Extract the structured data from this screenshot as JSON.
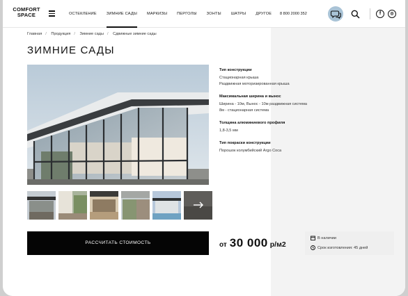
{
  "header": {
    "logo_line1": "COMFORT",
    "logo_line2": "SPACE",
    "nav": [
      "ОСТЕКЛЕНИЕ",
      "ЗИМНИЕ САДЫ",
      "МАРКИЗЫ",
      "ПЕРГОЛЫ",
      "ЗОНТЫ",
      "ШАТРЫ",
      "ДРУГОЕ"
    ],
    "active_nav": "ЗИМНИЕ САДЫ",
    "phone": "8 800 2000 352",
    "social": [
      "f",
      "◎"
    ]
  },
  "breadcrumb": [
    "Главная",
    "Продукция",
    "Зимние сады",
    "Сдвижные зимние сады"
  ],
  "page_title": "ЗИМНИЕ САДЫ",
  "specs": [
    {
      "heading": "Тип конструкции",
      "lines": [
        "Стационарная крыша",
        "Раздвижная моторизированная крыша"
      ]
    },
    {
      "heading": "Максимальная ширина и вынос",
      "lines": [
        "Ширина - 10м, Вынос - 10м раздвижная система",
        "8м - стационарная система"
      ]
    },
    {
      "heading": "Толщина алюминиевого профиля",
      "lines": [
        "1,8-3,5 мм"
      ]
    },
    {
      "heading": "Тип покраски конструкции",
      "lines": [
        "Порошок колумбийский Argo Coca"
      ]
    }
  ],
  "cta_button": "РАССЧИТАТЬ СТОИМОСТЬ",
  "price": {
    "prefix": "от",
    "value": "30 000",
    "unit": "р/м2"
  },
  "availability": {
    "status": "В наличии",
    "lead_time": "Срок изготовления: 45 дней"
  },
  "icons": {
    "menu": "hamburger-icon",
    "chat": "chat-icon",
    "search": "search-icon",
    "facebook": "facebook-icon",
    "instagram": "instagram-icon",
    "calendar": "calendar-icon",
    "clock": "clock-icon",
    "next_arrow": "arrow-right-icon"
  },
  "colors": {
    "accent_chat": "#a9c3d6",
    "button": "#050505",
    "panel": "#f3f3f3"
  }
}
